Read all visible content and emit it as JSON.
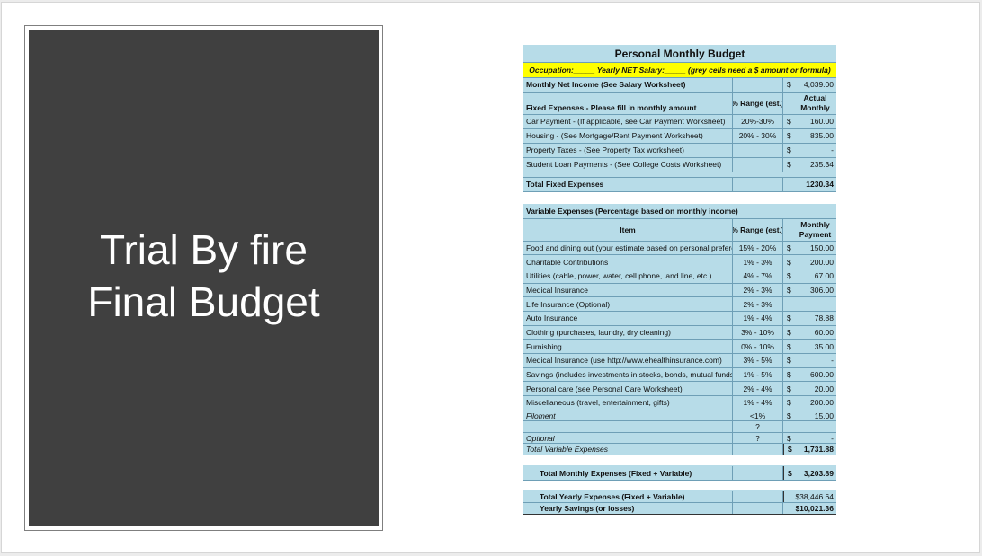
{
  "slide": {
    "title_line1": "Trial By fire",
    "title_line2": "Final Budget"
  },
  "budget": {
    "title": "Personal Monthly Budget",
    "occupation_line": "Occupation:_____ Yearly NET Salary:_____ (grey cells need a $ amount or formula)",
    "net_income": {
      "label": "Monthly Net Income (See Salary Worksheet)",
      "dollar": "$",
      "amount": "4,039.00"
    },
    "fixed_header": {
      "label": "Fixed Expenses - Please fill in monthly amount",
      "range": "% Range (est.)",
      "amount": "Actual Monthly"
    },
    "fixed_items": [
      {
        "item": "Car Payment - (If applicable, see Car Payment Worksheet)",
        "range": "20%-30%",
        "dollar": "$",
        "amount": "160.00"
      },
      {
        "item": "Housing - (See Mortgage/Rent Payment Worksheet)",
        "range": "20% - 30%",
        "dollar": "$",
        "amount": "835.00"
      },
      {
        "item": "Property Taxes - (See Property Tax worksheet)",
        "range": "",
        "dollar": "$",
        "amount": "-"
      },
      {
        "item": "Student Loan Payments - (See College Costs Worksheet)",
        "range": "",
        "dollar": "$",
        "amount": "235.34"
      }
    ],
    "total_fixed": {
      "label": "Total Fixed Expenses",
      "amount": "1230.34"
    },
    "variable_title": "Variable Expenses (Percentage based on monthly income)",
    "variable_header": {
      "item": "Item",
      "range": "% Range (est.)",
      "amount": "Monthly Payment"
    },
    "variable_items": [
      {
        "item": "Food and dining out (your estimate based on personal preference)",
        "range": "15% - 20%",
        "dollar": "$",
        "amount": "150.00",
        "italic": false
      },
      {
        "item": "Charitable Contributions",
        "range": "1% - 3%",
        "dollar": "$",
        "amount": "200.00",
        "italic": false
      },
      {
        "item": "Utilities (cable, power, water, cell phone, land line, etc.)",
        "range": "4% - 7%",
        "dollar": "$",
        "amount": "67.00",
        "italic": false
      },
      {
        "item": "Medical Insurance",
        "range": "2% - 3%",
        "dollar": "$",
        "amount": "306.00",
        "italic": false
      },
      {
        "item": "Life Insurance (Optional)",
        "range": "2% - 3%",
        "dollar": "",
        "amount": "",
        "italic": false
      },
      {
        "item": "Auto Insurance",
        "range": "1% - 4%",
        "dollar": "$",
        "amount": "78.88",
        "italic": false
      },
      {
        "item": "Clothing (purchases, laundry, dry cleaning)",
        "range": "3% - 10%",
        "dollar": "$",
        "amount": "60.00",
        "italic": false
      },
      {
        "item": "Furnishing",
        "range": "0% - 10%",
        "dollar": "$",
        "amount": "35.00",
        "italic": false
      },
      {
        "item": "Medical Insurance  (use http://www.ehealthinsurance.com)",
        "range": "3% - 5%",
        "dollar": "$",
        "amount": "-",
        "italic": false
      },
      {
        "item": "Savings (includes investments in stocks, bonds, mutual funds)",
        "range": "1% - 5%",
        "dollar": "$",
        "amount": "600.00",
        "italic": false
      },
      {
        "item": "Personal care (see Personal Care Worksheet)",
        "range": "2% - 4%",
        "dollar": "$",
        "amount": "20.00",
        "italic": false
      },
      {
        "item": "Miscellaneous (travel, entertainment, gifts)",
        "range": "1% - 4%",
        "dollar": "$",
        "amount": "200.00",
        "italic": false
      },
      {
        "item": "Filoment",
        "range": "<1%",
        "dollar": "$",
        "amount": "15.00",
        "italic": true
      },
      {
        "item": "",
        "range": "?",
        "dollar": "",
        "amount": "",
        "italic": true
      },
      {
        "item": "Optional",
        "range": "?",
        "dollar": "$",
        "amount": "-",
        "italic": true
      }
    ],
    "total_variable": {
      "label": "Total Variable Expenses",
      "dollar": "$",
      "amount": "1,731.88"
    },
    "total_monthly": {
      "label": "Total Monthly Expenses (Fixed + Variable)",
      "dollar": "$",
      "amount": "3,203.89"
    },
    "total_yearly": {
      "label": "Total Yearly Expenses (Fixed + Variable)",
      "amount": "$38,446.64"
    },
    "yearly_savings": {
      "label": "Yearly Savings (or losses)",
      "amount": "$10,021.36"
    }
  }
}
